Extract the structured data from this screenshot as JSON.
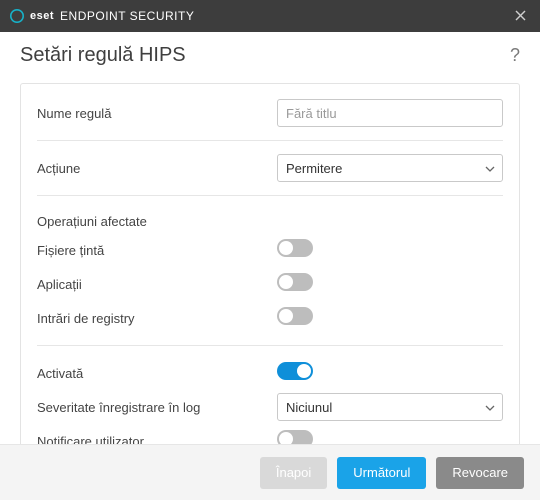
{
  "titlebar": {
    "brand_prefix": "eset",
    "product": "ENDPOINT SECURITY"
  },
  "page": {
    "title": "Setări regulă HIPS"
  },
  "fields": {
    "rule_name_label": "Nume regulă",
    "rule_name_placeholder": "Fără titlu",
    "action_label": "Acțiune",
    "action_value": "Permitere",
    "affected_ops_label": "Operațiuni afectate",
    "target_files_label": "Fișiere țintă",
    "applications_label": "Aplicații",
    "registry_entries_label": "Intrări de registry",
    "enabled_label": "Activată",
    "log_severity_label": "Severitate înregistrare în log",
    "log_severity_value": "Niciunul",
    "notify_user_label": "Notificare utilizator"
  },
  "toggles": {
    "target_files": false,
    "applications": false,
    "registry_entries": false,
    "enabled": true,
    "notify_user": false
  },
  "footer": {
    "back": "Înapoi",
    "next": "Următorul",
    "cancel": "Revocare"
  }
}
